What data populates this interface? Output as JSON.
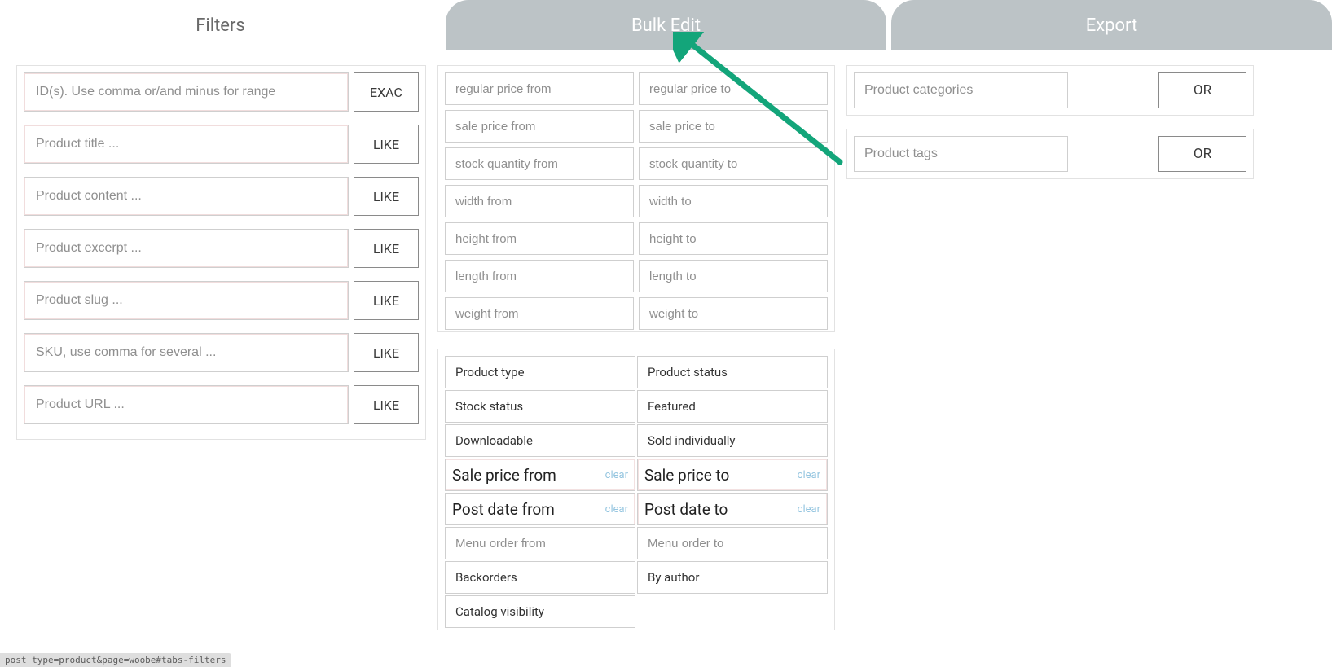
{
  "tabs": [
    {
      "label": "Filters",
      "active": true
    },
    {
      "label": "Bulk Edit",
      "active": false
    },
    {
      "label": "Export",
      "active": false
    }
  ],
  "left": {
    "rows": [
      {
        "placeholder": "ID(s). Use comma or/and minus for range",
        "mode": "EXAC"
      },
      {
        "placeholder": "Product title ...",
        "mode": "LIKE"
      },
      {
        "placeholder": "Product content ...",
        "mode": "LIKE"
      },
      {
        "placeholder": "Product excerpt ...",
        "mode": "LIKE"
      },
      {
        "placeholder": "Product slug ...",
        "mode": "LIKE"
      },
      {
        "placeholder": "SKU, use comma for several ...",
        "mode": "LIKE"
      },
      {
        "placeholder": "Product URL ...",
        "mode": "LIKE"
      }
    ]
  },
  "middle": {
    "ranges": [
      {
        "from": "regular price from",
        "to": "regular price to"
      },
      {
        "from": "sale price from",
        "to": "sale price to"
      },
      {
        "from": "stock quantity from",
        "to": "stock quantity to"
      },
      {
        "from": "width from",
        "to": "width to"
      },
      {
        "from": "height from",
        "to": "height to"
      },
      {
        "from": "length from",
        "to": "length to"
      },
      {
        "from": "weight from",
        "to": "weight to"
      }
    ],
    "selects": [
      {
        "left": "Product type",
        "right": "Product status",
        "kind": "select"
      },
      {
        "left": "Stock status",
        "right": "Featured",
        "kind": "select"
      },
      {
        "left": "Downloadable",
        "right": "Sold individually",
        "kind": "select"
      },
      {
        "left": "Sale price from",
        "right": "Sale price to",
        "kind": "date",
        "clear": "clear"
      },
      {
        "left": "Post date from",
        "right": "Post date to",
        "kind": "date",
        "clear": "clear"
      },
      {
        "left": "Menu order from",
        "right": "Menu order to",
        "kind": "range"
      },
      {
        "left": "Backorders",
        "right": "By author",
        "kind": "select"
      },
      {
        "left": "Catalog visibility",
        "kind": "select-half"
      }
    ]
  },
  "right": {
    "rows": [
      {
        "placeholder": "Product categories",
        "op": "OR"
      },
      {
        "placeholder": "Product tags",
        "op": "OR"
      }
    ]
  },
  "status_fragment": "post_type=product&page=woobe#tabs-filters"
}
